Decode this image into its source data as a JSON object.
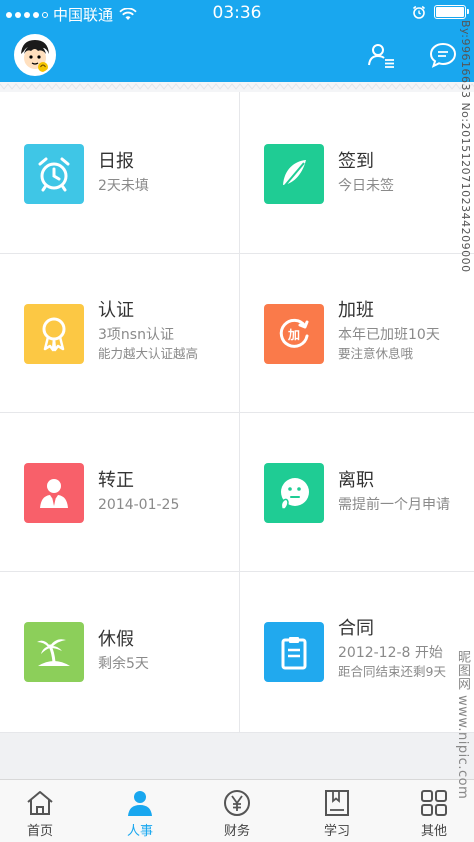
{
  "status_bar": {
    "carrier": "中国联通",
    "time": "03:36"
  },
  "header": {
    "avatar_icon": "avatar-cartoon",
    "contacts_icon": "contacts-list-icon",
    "message_icon": "chat-bubble-icon",
    "color": "#19a7ef"
  },
  "items": [
    {
      "title": "日报",
      "sub": "2天未填",
      "sub2": "",
      "icon": "alarm-clock-icon",
      "color": "#3fc6e6"
    },
    {
      "title": "签到",
      "sub": "今日未签",
      "sub2": "",
      "icon": "feather-icon",
      "color": "#1fcc94"
    },
    {
      "title": "认证",
      "sub": "3项nsn认证",
      "sub2": "能力越大认证越高",
      "icon": "badge-ribbon-icon",
      "color": "#fcc844"
    },
    {
      "title": "加班",
      "sub": "本年已加班10天",
      "sub2": "要注意休息哦",
      "icon": "overtime-add-icon",
      "color": "#fa7a4a"
    },
    {
      "title": "转正",
      "sub": "2014-01-25",
      "sub2": "",
      "icon": "person-suit-icon",
      "color": "#f8606a"
    },
    {
      "title": "离职",
      "sub": "需提前一个月申请",
      "sub2": "",
      "icon": "thinking-face-icon",
      "color": "#1fcc94"
    },
    {
      "title": "休假",
      "sub": "剩余5天",
      "sub2": "",
      "icon": "palm-island-icon",
      "color": "#8ccf5a"
    },
    {
      "title": "合同",
      "sub": "2012-12-8 开始",
      "sub2": "距合同结束还剩9天",
      "icon": "clipboard-icon",
      "color": "#21a9ee"
    }
  ],
  "tabs": [
    {
      "label": "首页",
      "icon": "home-icon",
      "active": false
    },
    {
      "label": "人事",
      "icon": "person-icon",
      "active": true
    },
    {
      "label": "财务",
      "icon": "yen-coin-icon",
      "active": false
    },
    {
      "label": "学习",
      "icon": "book-icon",
      "active": false
    },
    {
      "label": "其他",
      "icon": "grid-icon",
      "active": false
    }
  ],
  "watermark_right": "By:99616633 No:20151207102344209000",
  "watermark_bottom": "昵图网 www.nipic.com"
}
